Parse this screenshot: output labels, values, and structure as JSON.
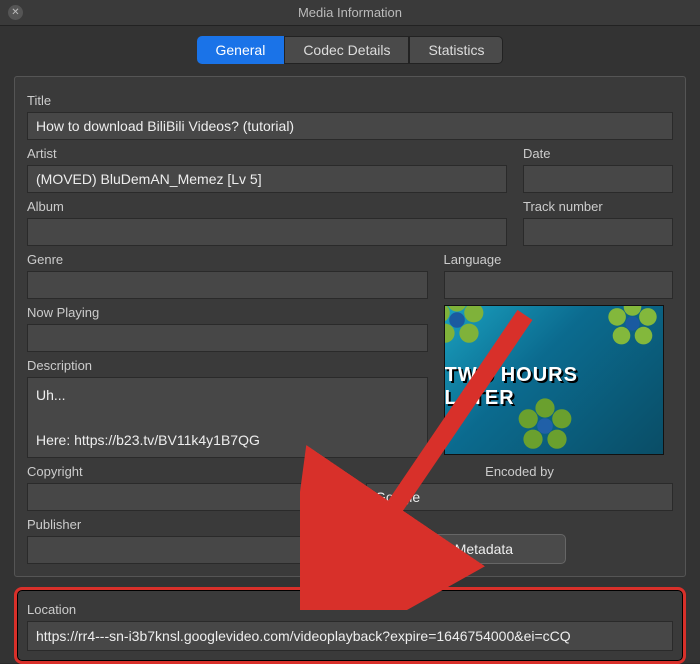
{
  "window": {
    "title": "Media Information"
  },
  "tabs": {
    "general": "General",
    "codec": "Codec Details",
    "stats": "Statistics"
  },
  "labels": {
    "title": "Title",
    "artist": "Artist",
    "date": "Date",
    "album": "Album",
    "track": "Track number",
    "genre": "Genre",
    "language": "Language",
    "nowplaying": "Now Playing",
    "description": "Description",
    "copyright": "Copyright",
    "encodedby": "Encoded by",
    "publisher": "Publisher",
    "location": "Location"
  },
  "values": {
    "title": "How to download BiliBili Videos? (tutorial)",
    "artist": "(MOVED) BluDemAN_Memez [Lv 5]",
    "date": "",
    "album": "",
    "track": "",
    "genre": "",
    "language": "",
    "nowplaying": "",
    "description": "Uh...\n\nHere: https://b23.tv/BV11k4y1B7QG",
    "copyright": "",
    "encodedby": "Google",
    "publisher": "",
    "location": "https://rr4---sn-i3b7knsl.googlevideo.com/videoplayback?expire=1646754000&ei=cCQ"
  },
  "thumb": {
    "overlay_text": "TWO HOURS LATER"
  },
  "buttons": {
    "save": "Save Metadata"
  }
}
